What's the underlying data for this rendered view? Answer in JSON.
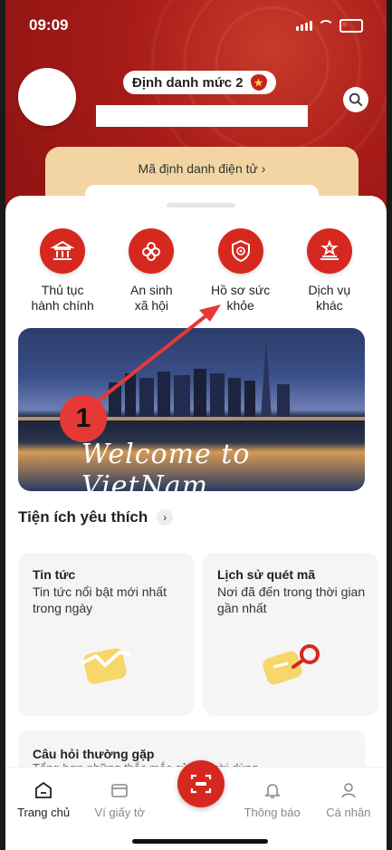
{
  "status_bar": {
    "time": "09:09"
  },
  "header": {
    "badge_label": "Định danh mức 2",
    "id_card_label": "Mã định danh điện tử  ›"
  },
  "services": [
    {
      "label": "Thủ tục\nhành chính",
      "icon": "bank-icon"
    },
    {
      "label": "An sinh\nxã hội",
      "icon": "flower-icon"
    },
    {
      "label": "Hồ sơ sức\nkhỏe",
      "icon": "health-shield-icon"
    },
    {
      "label": "Dịch vụ\nkhác",
      "icon": "star-podium-icon"
    }
  ],
  "banner": {
    "text": "Welcome to VietNam"
  },
  "annotation": {
    "number": "1",
    "color": "#e53935"
  },
  "favorites": {
    "title": "Tiện ích yêu thích",
    "cards": [
      {
        "title": "Tin tức",
        "desc": "Tin tức nổi bật mới nhất trong ngày"
      },
      {
        "title": "Lịch sử quét mã",
        "desc": "Nơi đã đến trong thời gian gần nhất"
      }
    ]
  },
  "faq": {
    "title": "Câu hỏi thường gặp",
    "desc": "Tổng hợp những thắc mắc của người dùng"
  },
  "bottom_nav": {
    "items": [
      {
        "label": "Trang chủ",
        "active": true
      },
      {
        "label": "Ví giấy tờ"
      },
      {
        "label": ""
      },
      {
        "label": "Thông báo"
      },
      {
        "label": "Cá nhân"
      }
    ]
  },
  "colors": {
    "brand_red": "#d6281f",
    "card_bg": "#f5f5f5",
    "id_card_bg": "#f2d5a3"
  }
}
